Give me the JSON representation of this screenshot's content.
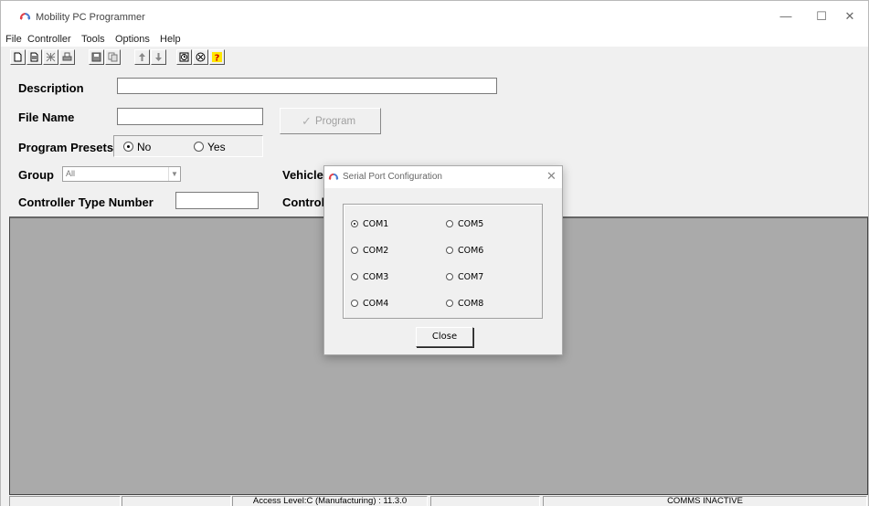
{
  "window": {
    "title": "Mobility PC Programmer",
    "controls": [
      "—",
      "☐",
      "✕"
    ]
  },
  "menu": [
    "File",
    "Controller",
    "Tools",
    "Options",
    "Help"
  ],
  "toolbar": {
    "icons": [
      "new-file-icon",
      "open-file-icon",
      "read-controller-icon",
      "print-icon",
      "save-icon",
      "copy-icon",
      "upload-icon",
      "download-icon",
      "clock-icon",
      "world-icon",
      "help-icon"
    ]
  },
  "form": {
    "description_label": "Description",
    "description_value": "",
    "file_name_label": "File Name",
    "file_name_value": "",
    "program_button": "Program",
    "presets_label": "Program Presets",
    "preset_no": "No",
    "preset_yes": "Yes",
    "preset_selected": "No",
    "group_label": "Group",
    "group_value": "All",
    "vehicle_label": "Vehicle",
    "controller_type_label": "Controller Type Number",
    "controller_type_value": "",
    "control_label": "Control"
  },
  "status": {
    "access_level": "Access Level:C (Manufacturing) : 11.3.0",
    "comms": "COMMS INACTIVE"
  },
  "dialog": {
    "title": "Serial Port Configuration",
    "close_x": "✕",
    "ports": [
      "COM1",
      "COM2",
      "COM3",
      "COM4",
      "COM5",
      "COM6",
      "COM7",
      "COM8"
    ],
    "selected_port": "COM1",
    "close_button": "Close"
  },
  "colors": {
    "content_panel": "#aaaaaa",
    "icon_red": "#e0404a",
    "icon_blue": "#4a7bd0"
  }
}
